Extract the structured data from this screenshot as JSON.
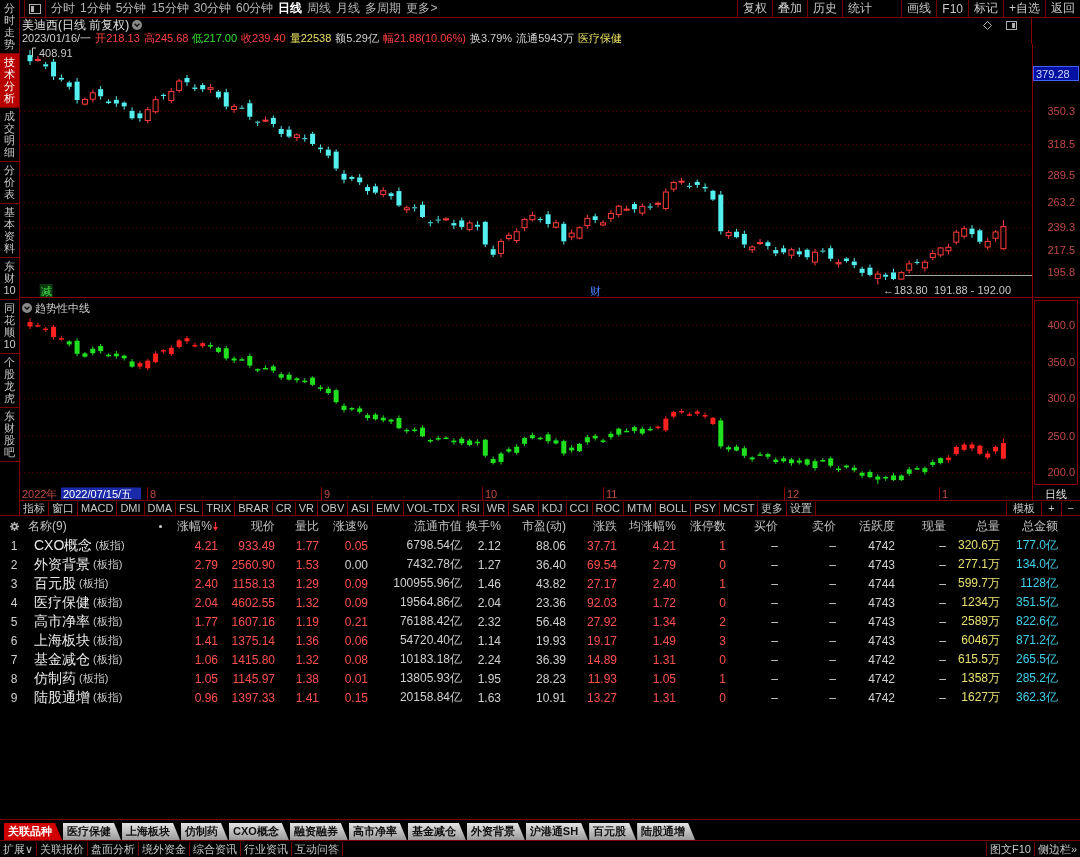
{
  "sidebar": {
    "items": [
      {
        "label": "分时走势",
        "selected": false
      },
      {
        "label": "技术分析",
        "selected": true
      },
      {
        "label": "成交明细",
        "selected": false
      },
      {
        "label": "分价表",
        "selected": false
      },
      {
        "label": "基本资料",
        "selected": false
      },
      {
        "label": "东财10",
        "selected": false
      },
      {
        "label": "同花顺10",
        "selected": false
      },
      {
        "label": "个股龙虎",
        "selected": false
      },
      {
        "label": "东财股吧",
        "selected": false
      }
    ]
  },
  "toolbar": {
    "periods": [
      {
        "label": "分时",
        "selected": false
      },
      {
        "label": "1分钟",
        "selected": false
      },
      {
        "label": "5分钟",
        "selected": false
      },
      {
        "label": "15分钟",
        "selected": false
      },
      {
        "label": "30分钟",
        "selected": false
      },
      {
        "label": "60分钟",
        "selected": false
      },
      {
        "label": "日线",
        "selected": true
      },
      {
        "label": "周线",
        "selected": false
      },
      {
        "label": "月线",
        "selected": false
      },
      {
        "label": "多周期",
        "selected": false
      },
      {
        "label": "更多>",
        "selected": false
      }
    ],
    "actions": [
      "复权",
      "叠加",
      "历史",
      "统计",
      "画线",
      "F10",
      "标记",
      "+自选",
      "返回"
    ]
  },
  "stock": {
    "title": "美迪西(日线 前复权)",
    "quote": [
      {
        "text": "2023/01/16/一",
        "kind": "plain"
      },
      {
        "text": "开218.13",
        "kind": "up"
      },
      {
        "text": "高245.68",
        "kind": "up"
      },
      {
        "text": "低217.00",
        "kind": "down"
      },
      {
        "text": "收239.40",
        "kind": "up"
      },
      {
        "text": "量22538",
        "kind": "volume"
      },
      {
        "text": "额5.29亿",
        "kind": "plain"
      },
      {
        "text": "幅21.88(10.06%)",
        "kind": "up"
      },
      {
        "text": "换3.79%",
        "kind": "plain"
      },
      {
        "text": "流通5943万",
        "kind": "plain"
      },
      {
        "text": "医疗保健",
        "kind": "sector"
      }
    ]
  },
  "price_chart": {
    "high_label": "408.91",
    "current_price": "379.28",
    "axis_labels": [
      "350.3",
      "318.5",
      "289.5",
      "263.2",
      "239.3",
      "217.5",
      "195.8"
    ],
    "low_label": "←183.80",
    "range_label": "191.88 - 192.00",
    "events": [
      {
        "text": "减",
        "kind": "reduce"
      },
      {
        "text": "财",
        "kind": "finance"
      }
    ]
  },
  "trend_chart": {
    "title": "趋势性中线",
    "axis_labels": [
      "400.0",
      "350.0",
      "300.0",
      "250.0",
      "200.0"
    ]
  },
  "date_axis": {
    "year": "2022年",
    "cursor_date": "2022/07/15/五",
    "months": [
      "8",
      "9",
      "10",
      "11",
      "12",
      "1"
    ],
    "period": "日线"
  },
  "indicator_bar": {
    "tabs": [
      "指标",
      "窗口",
      "MACD",
      "DMI",
      "DMA",
      "FSL",
      "TRIX",
      "BRAR",
      "CR",
      "VR",
      "OBV",
      "ASI",
      "EMV",
      "VOL-TDX",
      "RSI",
      "WR",
      "SAR",
      "KDJ",
      "CCI",
      "ROC",
      "MTM",
      "BOLL",
      "PSY",
      "MCST",
      "更多",
      "设置"
    ],
    "actions": [
      "模板",
      "+",
      "−"
    ]
  },
  "table": {
    "name_header": "名称(9)",
    "columns": [
      {
        "label": "涨幅%",
        "kind": "up",
        "sorted": true
      },
      {
        "label": "现价",
        "kind": "up",
        "sorted": false
      },
      {
        "label": "量比",
        "kind": "up",
        "sorted": false
      },
      {
        "label": "涨速%",
        "kind": "up",
        "sorted": false
      },
      {
        "label": "流通市值",
        "kind": "plain",
        "sorted": false
      },
      {
        "label": "换手%",
        "kind": "plain",
        "sorted": false
      },
      {
        "label": "市盈(动)",
        "kind": "plain",
        "sorted": false
      },
      {
        "label": "涨跌",
        "kind": "up",
        "sorted": false
      },
      {
        "label": "均涨幅%",
        "kind": "up",
        "sorted": false
      },
      {
        "label": "涨停数",
        "kind": "up",
        "sorted": false
      },
      {
        "label": "买价",
        "kind": "plain",
        "sorted": false
      },
      {
        "label": "卖价",
        "kind": "plain",
        "sorted": false
      },
      {
        "label": "活跃度",
        "kind": "plain",
        "sorted": false
      },
      {
        "label": "现量",
        "kind": "plain",
        "sorted": false
      },
      {
        "label": "总量",
        "kind": "volume",
        "sorted": false
      },
      {
        "label": "总金额",
        "kind": "amount",
        "sorted": false
      }
    ],
    "rows": [
      {
        "rank": "1",
        "name": "CXO概念",
        "tag": "(板指)",
        "speed_flat": false,
        "values": [
          "4.21",
          "933.49",
          "1.77",
          "0.05",
          "6798.54亿",
          "2.12",
          "88.06",
          "37.71",
          "4.21",
          "1",
          "–",
          "–",
          "4742",
          "–",
          "320.6万",
          "177.0亿"
        ]
      },
      {
        "rank": "2",
        "name": "外资背景",
        "tag": "(板指)",
        "speed_flat": true,
        "values": [
          "2.79",
          "2560.90",
          "1.53",
          "0.00",
          "7432.78亿",
          "1.27",
          "36.40",
          "69.54",
          "2.79",
          "0",
          "–",
          "–",
          "4743",
          "–",
          "277.1万",
          "134.0亿"
        ]
      },
      {
        "rank": "3",
        "name": "百元股",
        "tag": "(板指)",
        "speed_flat": false,
        "values": [
          "2.40",
          "1158.13",
          "1.29",
          "0.09",
          "100955.96亿",
          "1.46",
          "43.82",
          "27.17",
          "2.40",
          "1",
          "–",
          "–",
          "4744",
          "–",
          "599.7万",
          "1128亿"
        ]
      },
      {
        "rank": "4",
        "name": "医疗保健",
        "tag": "(板指)",
        "speed_flat": false,
        "values": [
          "2.04",
          "4602.55",
          "1.32",
          "0.09",
          "19564.86亿",
          "2.04",
          "23.36",
          "92.03",
          "1.72",
          "0",
          "–",
          "–",
          "4743",
          "–",
          "1234万",
          "351.5亿"
        ]
      },
      {
        "rank": "5",
        "name": "高市净率",
        "tag": "(板指)",
        "speed_flat": false,
        "values": [
          "1.77",
          "1607.16",
          "1.19",
          "0.21",
          "76188.42亿",
          "2.32",
          "56.48",
          "27.92",
          "1.34",
          "2",
          "–",
          "–",
          "4743",
          "–",
          "2589万",
          "822.6亿"
        ]
      },
      {
        "rank": "6",
        "name": "上海板块",
        "tag": "(板指)",
        "speed_flat": false,
        "values": [
          "1.41",
          "1375.14",
          "1.36",
          "0.06",
          "54720.40亿",
          "1.14",
          "19.93",
          "19.17",
          "1.49",
          "3",
          "–",
          "–",
          "4743",
          "–",
          "6046万",
          "871.2亿"
        ]
      },
      {
        "rank": "7",
        "name": "基金减仓",
        "tag": "(板指)",
        "speed_flat": false,
        "values": [
          "1.06",
          "1415.80",
          "1.32",
          "0.08",
          "10183.18亿",
          "2.24",
          "36.39",
          "14.89",
          "1.31",
          "0",
          "–",
          "–",
          "4742",
          "–",
          "615.5万",
          "265.5亿"
        ]
      },
      {
        "rank": "8",
        "name": "仿制药",
        "tag": "(板指)",
        "speed_flat": false,
        "values": [
          "1.05",
          "1145.97",
          "1.38",
          "0.01",
          "13805.93亿",
          "1.95",
          "28.23",
          "11.93",
          "1.05",
          "1",
          "–",
          "–",
          "4742",
          "–",
          "1358万",
          "285.2亿"
        ]
      },
      {
        "rank": "9",
        "name": "陆股通增",
        "tag": "(板指)",
        "speed_flat": false,
        "values": [
          "0.96",
          "1397.33",
          "1.41",
          "0.15",
          "20158.84亿",
          "1.63",
          "10.91",
          "13.27",
          "1.31",
          "0",
          "–",
          "–",
          "4742",
          "–",
          "1627万",
          "362.3亿"
        ]
      }
    ]
  },
  "related_tabs": [
    {
      "label": "关联品种",
      "selected": true
    },
    {
      "label": "医疗保健",
      "selected": false
    },
    {
      "label": "上海板块",
      "selected": false
    },
    {
      "label": "仿制药",
      "selected": false
    },
    {
      "label": "CXO概念",
      "selected": false
    },
    {
      "label": "融资融券",
      "selected": false
    },
    {
      "label": "高市净率",
      "selected": false
    },
    {
      "label": "基金减仓",
      "selected": false
    },
    {
      "label": "外资背景",
      "selected": false
    },
    {
      "label": "沪港通SH",
      "selected": false
    },
    {
      "label": "百元股",
      "selected": false
    },
    {
      "label": "陆股通增",
      "selected": false
    }
  ],
  "bottom_bar": {
    "links": [
      "扩展∨",
      "关联报价",
      "盘面分析",
      "境外资金",
      "综合资讯",
      "行业资讯",
      "互动问答"
    ],
    "right": [
      "图文F10",
      "侧边栏»"
    ]
  }
}
